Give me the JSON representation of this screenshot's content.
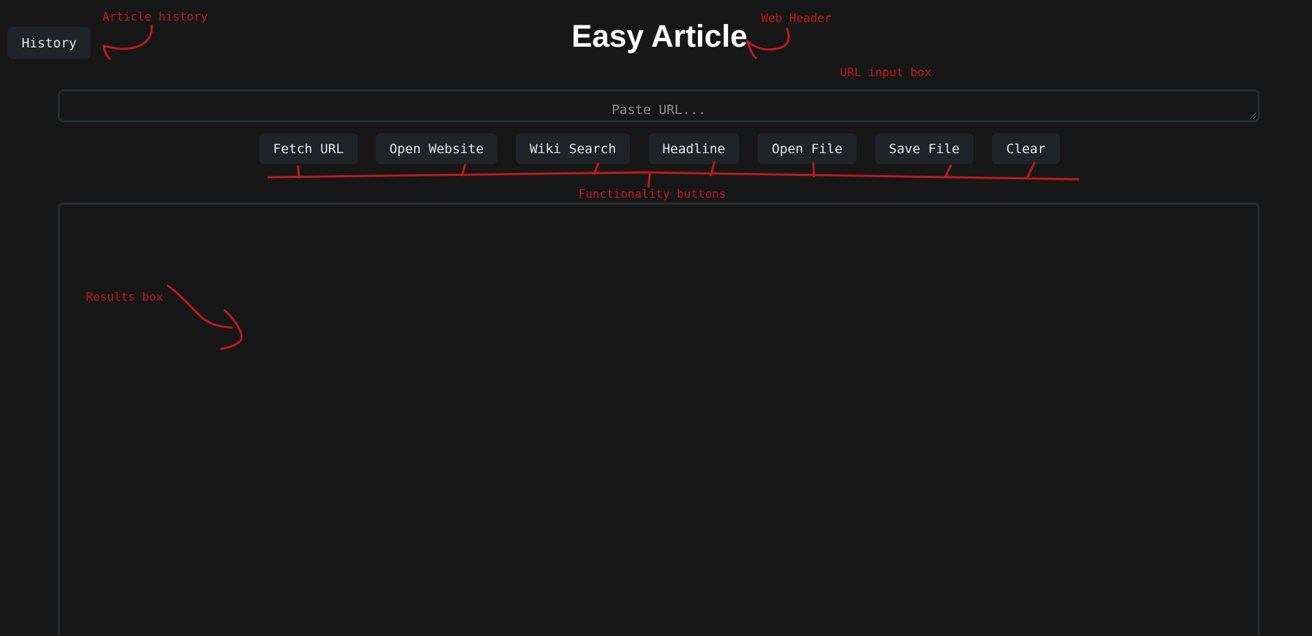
{
  "history_button": {
    "label": "History"
  },
  "header": {
    "title": "Easy Article"
  },
  "url_input": {
    "placeholder": "Paste URL..."
  },
  "toolbar": {
    "buttons": [
      {
        "id": "fetch-url",
        "label": "Fetch URL"
      },
      {
        "id": "open-website",
        "label": "Open Website"
      },
      {
        "id": "wiki-search",
        "label": "Wiki Search"
      },
      {
        "id": "headline",
        "label": "Headline"
      },
      {
        "id": "open-file",
        "label": "Open File"
      },
      {
        "id": "save-file",
        "label": "Save File"
      },
      {
        "id": "clear",
        "label": "Clear"
      }
    ]
  },
  "annotations": {
    "article_history": "Article history",
    "web_header": "Web Header",
    "url_input_box": "URL input box",
    "functionality_buttons": "Functionality buttons",
    "results_box": "Results box"
  },
  "colors": {
    "background": "#171717",
    "button_bg": "#1f2428",
    "border": "#262d30",
    "annotation": "#c41a1a",
    "title": "#ffffff",
    "placeholder": "#8b8b8b"
  }
}
